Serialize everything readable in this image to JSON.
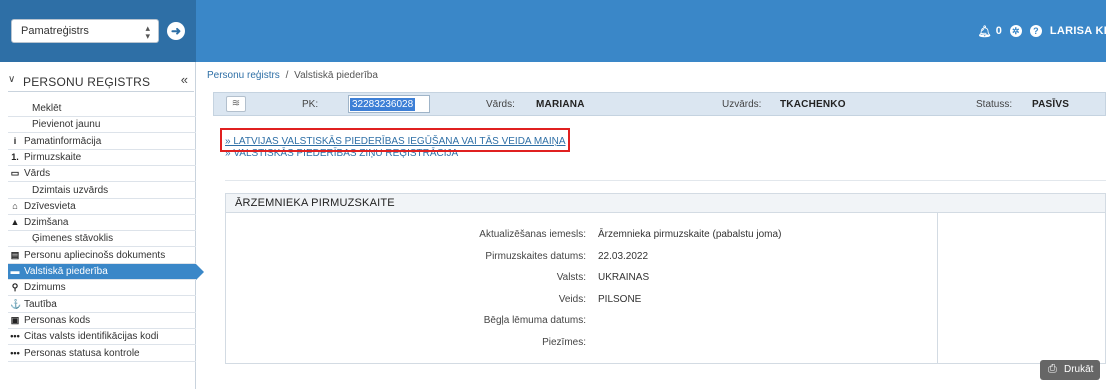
{
  "header": {
    "module_select": "Pamatreģistrs",
    "notification_count": "0",
    "user_name": "LARISA KR"
  },
  "sidebar": {
    "title": "PERSONU REĢISTRS",
    "items": [
      {
        "label": "Meklēt",
        "icon": "",
        "sub": true
      },
      {
        "label": "Pievienot jaunu",
        "icon": "",
        "sub": true
      },
      {
        "label": "Pamatinformācija",
        "icon": "info-icon",
        "glyph": "i"
      },
      {
        "label": "Pirmuzskaite",
        "icon": "first-icon",
        "glyph": "1."
      },
      {
        "label": "Vārds",
        "icon": "name-card-icon",
        "glyph": "▭"
      },
      {
        "label": "Dzimtais uzvārds",
        "icon": "",
        "sub": true
      },
      {
        "label": "Dzīvesvieta",
        "icon": "home-icon",
        "glyph": "⌂"
      },
      {
        "label": "Dzimšana",
        "icon": "birth-icon",
        "glyph": "▲"
      },
      {
        "label": "Ģimenes stāvoklis",
        "icon": "",
        "sub": true
      },
      {
        "label": "Personu apliecinošs dokuments",
        "icon": "document-icon",
        "glyph": "▤"
      },
      {
        "label": "Valstiskā piederība",
        "icon": "citizenship-icon",
        "glyph": "▬",
        "active": true
      },
      {
        "label": "Dzimums",
        "icon": "gender-icon",
        "glyph": "⚲"
      },
      {
        "label": "Tautība",
        "icon": "anchor-icon",
        "glyph": "⚓"
      },
      {
        "label": "Personas kods",
        "icon": "id-card-icon",
        "glyph": "▣"
      },
      {
        "label": "Citas valsts identifikācijas kodi",
        "icon": "codes-icon",
        "glyph": "•••"
      },
      {
        "label": "Personas statusa kontrole",
        "icon": "status-icon",
        "glyph": "•••"
      }
    ]
  },
  "breadcrumb": {
    "root": "Personu reģistrs",
    "separator": "/",
    "current": "Valstiskā piederība"
  },
  "person": {
    "pk_label": "PK:",
    "pk_value": "32283236028",
    "first_name_label": "Vārds:",
    "first_name": "MARIANA",
    "last_name_label": "Uzvārds:",
    "last_name": "TKACHENKO",
    "status_label": "Statuss:",
    "status": "PASĪVS"
  },
  "links": [
    "» LATVIJAS VALSTISKĀS PIEDERĪBAS IEGŪŠANA VAI TĀS VEIDA MAIŅA",
    "» VALSTISKĀS PIEDERĪBAS ZIŅU REĢISTRĀCIJA"
  ],
  "panel": {
    "title": "ĀRZEMNIEKA PIRMUZSKAITE",
    "fields": [
      {
        "label": "Aktualizēšanas iemesls:",
        "value": "Ārzemnieka pirmuzskaite (pabalstu joma)"
      },
      {
        "label": "Pirmuzskaites datums:",
        "value": "22.03.2022"
      },
      {
        "label": "Valsts:",
        "value": "UKRAINAS"
      },
      {
        "label": "Veids:",
        "value": "PILSONE"
      },
      {
        "label": "Bēgļa lēmuma datums:",
        "value": ""
      },
      {
        "label": "Piezīmes:",
        "value": ""
      }
    ],
    "print_label": "Drukāt"
  },
  "colors": {
    "topbar": "#3a87c8",
    "topbar_left": "#2e6fa6",
    "active_item": "#3a87c8",
    "highlight_box": "#e02020",
    "link": "#2e6fa6"
  }
}
